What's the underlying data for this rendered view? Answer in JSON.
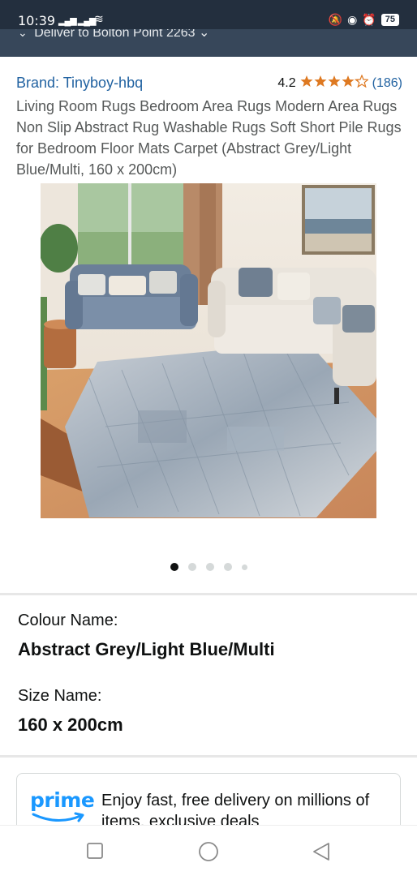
{
  "status_bar": {
    "time": "10:39",
    "battery": "75"
  },
  "location_bar": {
    "text": "Deliver to Bolton Point 2263"
  },
  "product": {
    "brand": "Brand: Tinyboy-hbq",
    "rating_value": "4.2",
    "rating_stars": 4.2,
    "rating_count": "(186)",
    "title": "Living Room Rugs Bedroom Area Rugs Modern Area Rugs Non Slip Abstract Rug Washable Rugs Soft Short Pile Rugs for Bedroom Floor Mats Carpet (Abstract Grey/Light Blue/Multi, 160 x 200cm)"
  },
  "gallery": {
    "image_count": 5,
    "active_index": 0
  },
  "variations": {
    "colour_label": "Colour Name:",
    "colour_value": "Abstract Grey/Light Blue/Multi",
    "size_label": "Size Name:",
    "size_value": "160 x 200cm"
  },
  "prime": {
    "logo_text": "prime",
    "message": "Enjoy fast, free delivery on millions of items, exclusive deals"
  },
  "icons": {
    "stars": "star-icon",
    "nav_recents": "square-icon",
    "nav_home": "circle-icon",
    "nav_back": "triangle-back-icon"
  },
  "colors": {
    "header_dark": "#232f3e",
    "location_bar": "#37475a",
    "link": "#2162a1",
    "star": "#de7921",
    "prime_blue": "#1a98ff"
  }
}
